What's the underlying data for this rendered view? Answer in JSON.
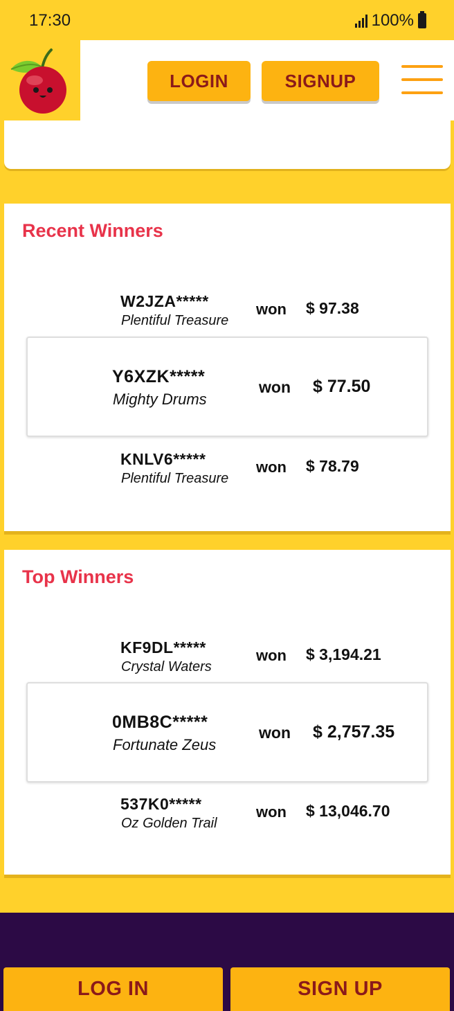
{
  "status_bar": {
    "time": "17:30",
    "battery": "100%"
  },
  "header": {
    "login_label": "LOGIN",
    "signup_label": "SIGNUP"
  },
  "recent_winners": {
    "title": "Recent Winners",
    "rows": [
      {
        "user": "W2JZA*****",
        "game": "Plentiful Treasure",
        "won": "won",
        "amount": "$ 97.38"
      },
      {
        "user": "Y6XZK*****",
        "game": "Mighty Drums",
        "won": "won",
        "amount": "$ 77.50"
      },
      {
        "user": "KNLV6*****",
        "game": "Plentiful Treasure",
        "won": "won",
        "amount": "$ 78.79"
      }
    ]
  },
  "top_winners": {
    "title": "Top Winners",
    "rows": [
      {
        "user": "KF9DL*****",
        "game": "Crystal Waters",
        "won": "won",
        "amount": "$ 3,194.21"
      },
      {
        "user": "0MB8C*****",
        "game": "Fortunate Zeus",
        "won": "won",
        "amount": "$ 2,757.35"
      },
      {
        "user": "537K0*****",
        "game": "Oz Golden Trail",
        "won": "won",
        "amount": "$ 13,046.70"
      }
    ]
  },
  "footer": {
    "login_label": "LOG IN",
    "signup_label": "SIGN UP"
  },
  "colors": {
    "brand_yellow": "#FFD12B",
    "button_orange": "#FDB311",
    "button_text": "#8B1A1A",
    "title_red": "#E8334A",
    "footer_purple": "#2C0A45"
  },
  "icons": [
    "signal-icon",
    "battery-icon",
    "cherry-logo",
    "menu-icon"
  ]
}
